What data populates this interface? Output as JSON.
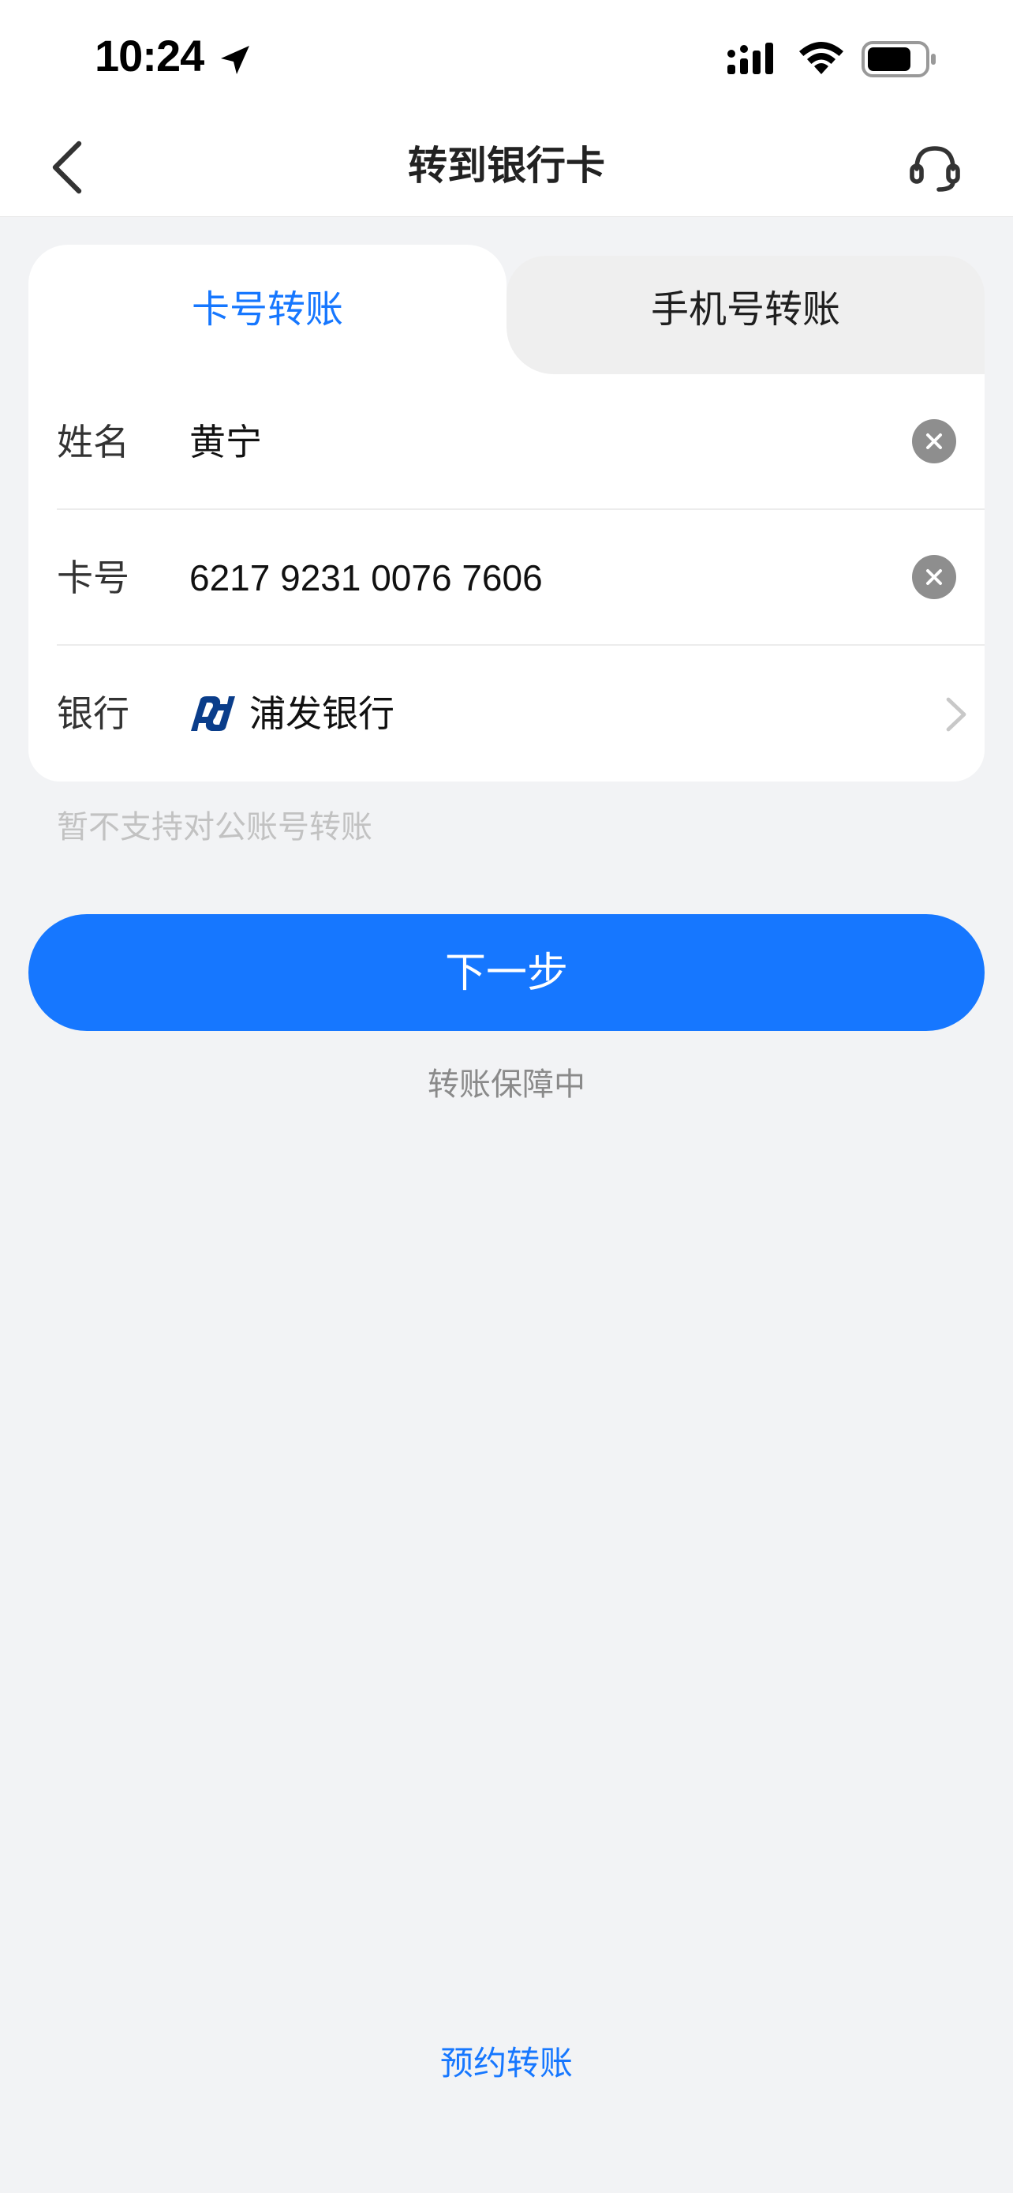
{
  "status_bar": {
    "time": "10:24"
  },
  "nav": {
    "title": "转到银行卡"
  },
  "tabs": [
    {
      "label": "卡号转账",
      "active": true
    },
    {
      "label": "手机号转账",
      "active": false
    }
  ],
  "form": {
    "name": {
      "label": "姓名",
      "value": "黄宁"
    },
    "card": {
      "label": "卡号",
      "value": "6217 9231 0076 7606"
    },
    "bank": {
      "label": "银行",
      "value": "浦发银行",
      "icon": "spdb-logo-icon"
    }
  },
  "hint": "暂不支持对公账号转账",
  "next_button": "下一步",
  "guarantee": "转账保障中",
  "scheduled_link": "预约转账",
  "colors": {
    "accent": "#1677ff",
    "background": "#f2f3f5",
    "bank_logo": "#0a3d8a"
  }
}
